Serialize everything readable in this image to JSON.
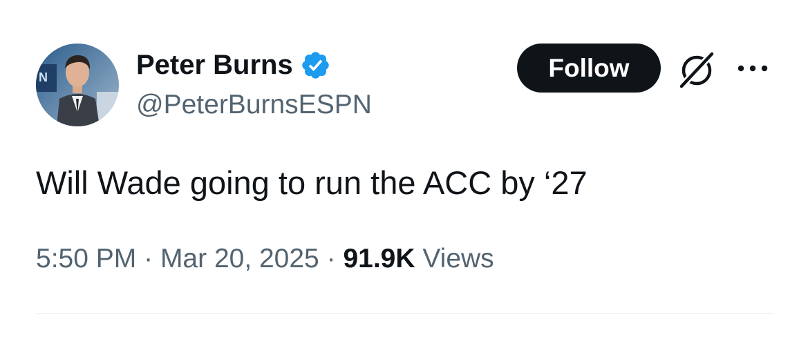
{
  "author": {
    "display_name": "Peter Burns",
    "handle": "@PeterBurnsESPN",
    "verified": true,
    "avatar": "profile-photo"
  },
  "actions": {
    "follow_label": "Follow",
    "grok_icon": "grok-icon",
    "more_icon": "more-icon"
  },
  "tweet": {
    "text": "Will Wade going to run the ACC by ‘27",
    "time": "5:50 PM",
    "separator": "·",
    "date": "Mar 20, 2025",
    "views_count": "91.9K",
    "views_label": "Views"
  },
  "colors": {
    "text_primary": "#0f1419",
    "text_secondary": "#536471",
    "verified_blue": "#1d9bf0",
    "button_bg": "#0f1419",
    "divider": "#eff3f4"
  }
}
